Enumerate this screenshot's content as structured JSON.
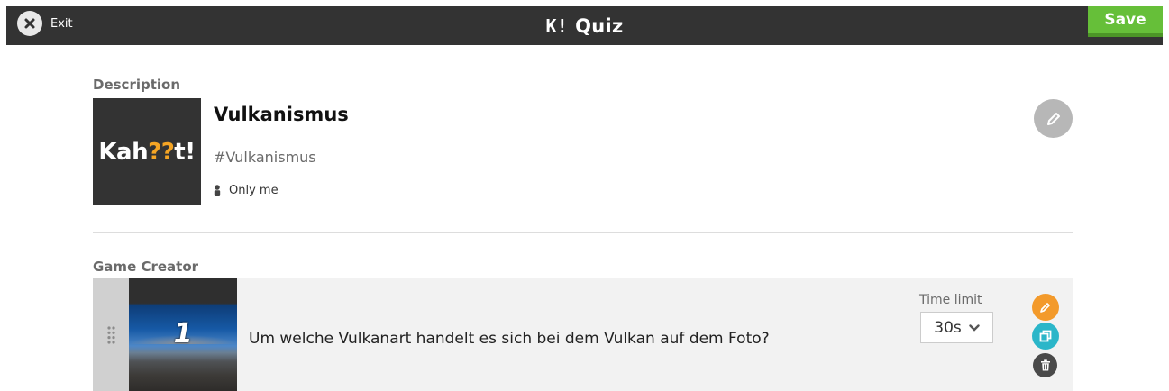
{
  "header": {
    "exit_label": "Exit",
    "brand_mark": "K!",
    "brand_title": "Quiz",
    "save_label": "Save"
  },
  "description": {
    "section_label": "Description",
    "cover_logo": {
      "a": "Kah",
      "b": "??",
      "c": "t!"
    },
    "title": "Vulkanismus",
    "tag": "#Vulkanismus",
    "visibility": "Only me"
  },
  "game_creator": {
    "section_label": "Game Creator",
    "questions": [
      {
        "number": "1",
        "text": "Um welche Vulkanart handelt es sich bei dem Vulkan auf dem Foto?",
        "time_limit_label": "Time limit",
        "time_limit_value": "30s"
      }
    ]
  },
  "colors": {
    "topbar": "#333333",
    "save": "#66bf39",
    "edit_action": "#f39a2b",
    "duplicate_action": "#2bb6c9",
    "delete_action": "#4a4a4a"
  },
  "icons": [
    "close-icon",
    "person-icon",
    "pencil-icon",
    "drag-handle-icon",
    "chevron-down-icon",
    "duplicate-icon",
    "trash-icon"
  ]
}
